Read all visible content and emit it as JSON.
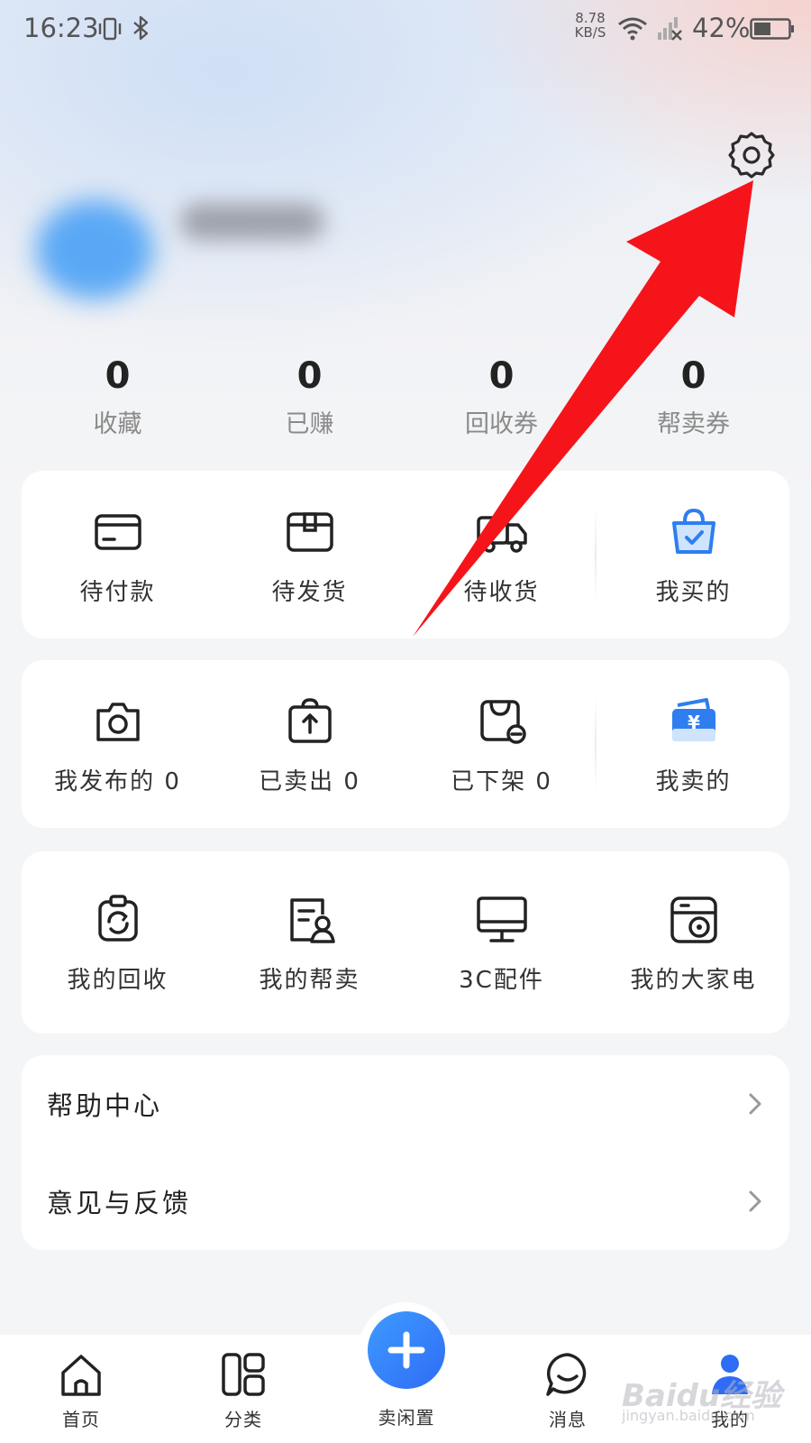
{
  "status_bar": {
    "time": "16:23",
    "speed_value": "8.78",
    "speed_unit": "KB/S",
    "battery_percent": "42%"
  },
  "header": {
    "settings_icon": "gear-icon"
  },
  "stats": [
    {
      "value": "0",
      "label": "收藏"
    },
    {
      "value": "0",
      "label": "已赚"
    },
    {
      "value": "0",
      "label": "回收券"
    },
    {
      "value": "0",
      "label": "帮卖券"
    }
  ],
  "orders_card": {
    "items": [
      {
        "label": "待付款",
        "icon": "card-icon"
      },
      {
        "label": "待发货",
        "icon": "package-icon"
      },
      {
        "label": "待收货",
        "icon": "truck-icon"
      },
      {
        "label": "我买的",
        "icon": "shopping-bag-icon"
      }
    ]
  },
  "selling_card": {
    "items": [
      {
        "label": "我发布的 0",
        "icon": "camera-icon"
      },
      {
        "label": "已卖出 0",
        "icon": "upload-bag-icon"
      },
      {
        "label": "已下架 0",
        "icon": "bag-minus-icon"
      },
      {
        "label": "我卖的",
        "icon": "wallet-yen-icon"
      }
    ]
  },
  "services_card": {
    "items": [
      {
        "label": "我的回收",
        "icon": "recycle-icon"
      },
      {
        "label": "我的帮卖",
        "icon": "helper-icon"
      },
      {
        "label": "3C配件",
        "icon": "monitor-icon"
      },
      {
        "label": "我的大家电",
        "icon": "appliance-icon"
      }
    ]
  },
  "list_card": {
    "rows": [
      {
        "label": "帮助中心"
      },
      {
        "label": "意见与反馈"
      }
    ]
  },
  "tabbar": {
    "tabs": [
      {
        "label": "首页",
        "icon": "home-icon"
      },
      {
        "label": "分类",
        "icon": "category-icon"
      },
      {
        "label": "卖闲置",
        "icon": "plus-icon"
      },
      {
        "label": "消息",
        "icon": "message-icon"
      },
      {
        "label": "我的",
        "icon": "user-icon"
      }
    ],
    "active_color": "#2e6cf6"
  },
  "annotation": {
    "arrow_color": "#f5141a"
  },
  "watermark": {
    "text": "Baidu经验",
    "sub": "jingyan.baidu.com"
  }
}
